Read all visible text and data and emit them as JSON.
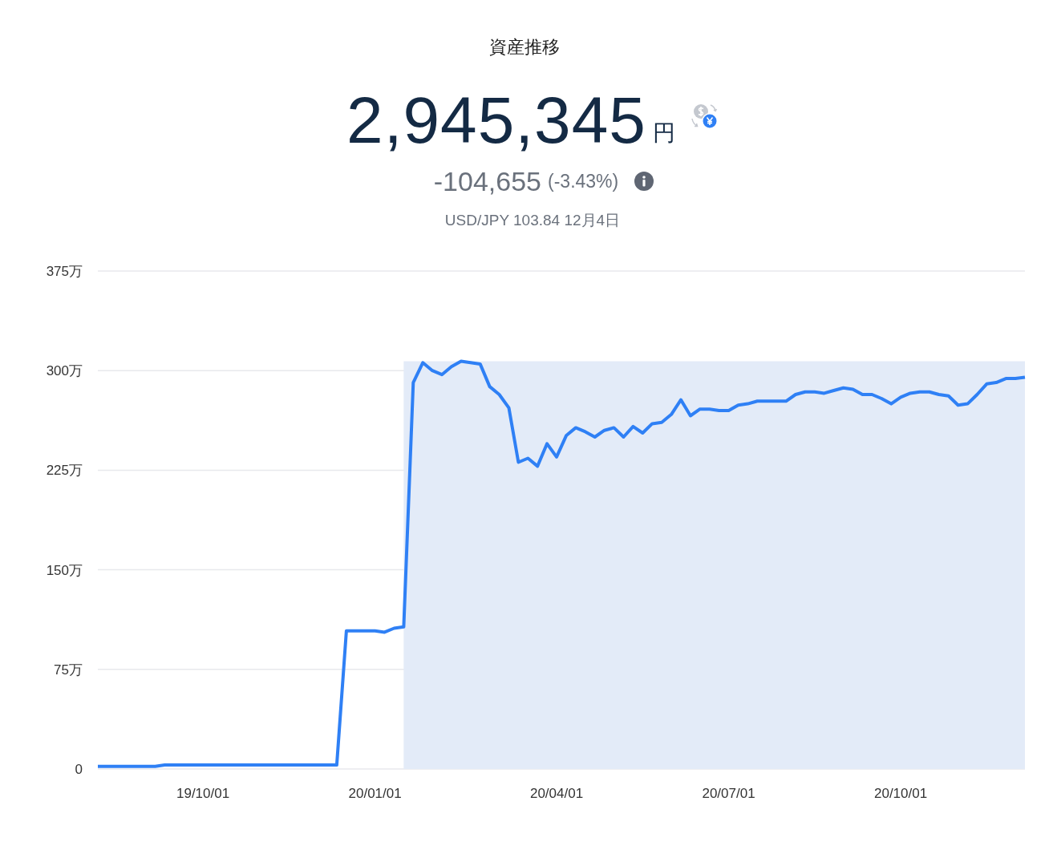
{
  "title": "資産推移",
  "total": {
    "amount": "2,945,345",
    "unit": "円"
  },
  "change": {
    "amount": "-104,655",
    "percent": "(-3.43%)"
  },
  "rate": "USD/JPY 103.84 12月4日",
  "chart_data": {
    "type": "line",
    "grid": true,
    "ylim": [
      0,
      375
    ],
    "yticks": [
      {
        "value": 0,
        "label": "0"
      },
      {
        "value": 75,
        "label": "75万"
      },
      {
        "value": 150,
        "label": "150万"
      },
      {
        "value": 225,
        "label": "225万"
      },
      {
        "value": 300,
        "label": "300万"
      },
      {
        "value": 375,
        "label": "375万"
      }
    ],
    "categories": [
      null,
      null,
      null,
      null,
      null,
      null,
      null,
      null,
      null,
      null,
      null,
      "19/10/01",
      null,
      null,
      null,
      null,
      null,
      null,
      null,
      null,
      null,
      null,
      null,
      null,
      null,
      null,
      null,
      null,
      null,
      "20/01/01",
      null,
      null,
      null,
      null,
      null,
      null,
      null,
      null,
      null,
      null,
      null,
      null,
      null,
      null,
      null,
      null,
      null,
      null,
      "20/04/01",
      null,
      null,
      null,
      null,
      null,
      null,
      null,
      null,
      null,
      null,
      null,
      null,
      null,
      null,
      null,
      null,
      null,
      "20/07/01",
      null,
      null,
      null,
      null,
      null,
      null,
      null,
      null,
      null,
      null,
      null,
      null,
      null,
      null,
      null,
      null,
      null,
      "20/10/01",
      null,
      null,
      null,
      null,
      null,
      null,
      null,
      null,
      null,
      null,
      null,
      null,
      null
    ],
    "series": [
      {
        "color": "#2f80f5",
        "values": [
          2,
          2,
          2,
          2,
          2,
          2,
          2,
          3,
          3,
          3,
          3,
          3,
          3,
          3,
          3,
          3,
          3,
          3,
          3,
          3,
          3,
          3,
          3,
          3,
          3,
          3,
          104,
          104,
          104,
          104,
          103,
          106,
          107,
          291,
          306,
          300,
          297,
          303,
          307,
          306,
          305,
          288,
          282,
          272,
          231,
          234,
          228,
          245,
          235,
          251,
          257,
          254,
          250,
          255,
          257,
          250,
          258,
          253,
          260,
          261,
          267,
          278,
          266,
          271,
          271,
          270,
          270,
          274,
          275,
          277,
          277,
          277,
          277,
          282,
          284,
          284,
          283,
          285,
          287,
          286,
          282,
          282,
          279,
          275,
          280,
          283,
          284,
          284,
          282,
          281,
          274,
          275,
          282,
          290,
          291,
          294,
          294,
          295
        ]
      }
    ]
  }
}
